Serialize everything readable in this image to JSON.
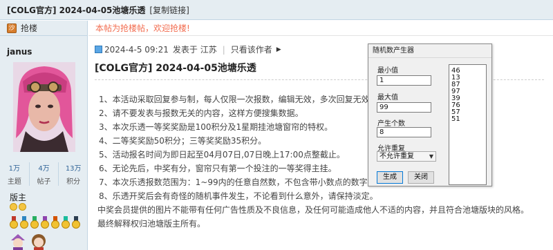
{
  "thread": {
    "title": "[COLG官方] 2024-04-05池塘乐透",
    "copy_link": "[复制链接]"
  },
  "sidebar": {
    "sofa_label": "抢楼",
    "username": "janus",
    "stats": [
      {
        "value": "1万",
        "label": "主题"
      },
      {
        "value": "4万",
        "label": "帖子"
      },
      {
        "value": "13万",
        "label": "积分"
      }
    ],
    "role": "版主"
  },
  "announce": "本帖为抢楼帖，欢迎抢楼!",
  "post": {
    "date": "2024-4-5 09:21",
    "posted_in": "发表于 江苏",
    "author_only": "只看该作者",
    "title": "[COLG官方] 2024-04-05池塘乐透",
    "lines": [
      "1、本活动采取回复参与制，每人仅限一次报数，编辑无效，多次回复无效。",
      "2、请不要发表与报数无关的内容，这样方便搜集数据。",
      "3、本次乐透一等奖奖励是100积分及1星期挂池塘窗帘的特权。",
      "4、二等奖奖励50积分；三等奖奖励35积分。",
      "5、活动报名时间为即日起至04月07日,07日晚上17:00点整截止。",
      "6、无论先后，中奖有分，窗帘只有第一个投注的一等奖得主挂。",
      "7、本次乐透报数范围为：1~99内的任意自然数，不包含带小数点的数字。",
      "8、乐透开奖后会有奇怪的随机事件发生，不论看到什么意外，请保持淡定。",
      "中奖会员提供的图片不能带有任何广告性质及不良信息，及任何可能造成他人不适的内容，并且符合池塘版块的风格。",
      "最终解释权归池塘版主所有。"
    ]
  },
  "dialog": {
    "title": "随机数产生器",
    "min_label": "最小值",
    "min_value": "1",
    "max_label": "最大值",
    "max_value": "99",
    "count_label": "产生个数",
    "count_value": "8",
    "repeat_label": "允许重复",
    "repeat_value": "不允许重复",
    "generate_label": "生成",
    "close_label": "关闭",
    "results": [
      "46",
      "13",
      "87",
      "97",
      "39",
      "76",
      "57",
      "51"
    ]
  },
  "colors": {
    "announce": "#f26c4f",
    "sidebar_bg": "#e5edf2",
    "stat_value": "#336699"
  }
}
